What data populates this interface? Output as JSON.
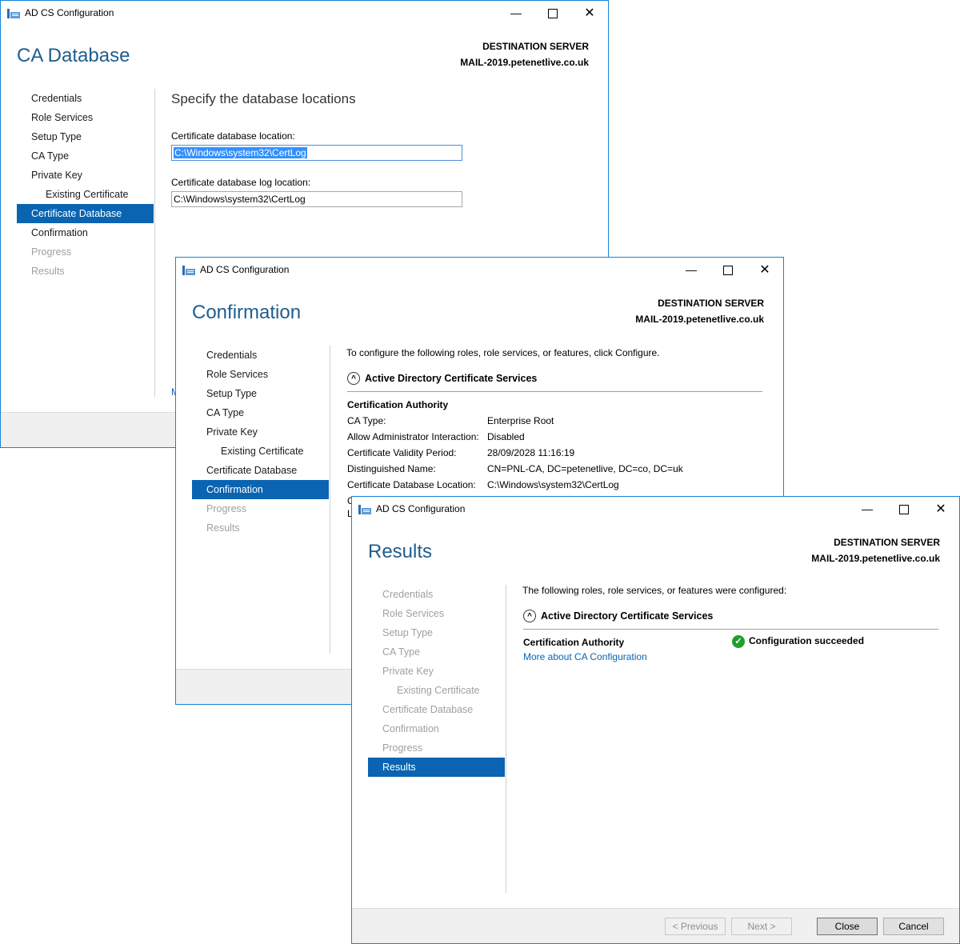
{
  "app_title": "AD CS Configuration",
  "destination": {
    "label": "DESTINATION SERVER",
    "server": "MAIL-2019.petenetlive.co.uk"
  },
  "nav_items": {
    "credentials": "Credentials",
    "role_services": "Role Services",
    "setup_type": "Setup Type",
    "ca_type": "CA Type",
    "private_key": "Private Key",
    "existing_certificate": "Existing Certificate",
    "certificate_database": "Certificate Database",
    "confirmation": "Confirmation",
    "progress": "Progress",
    "results": "Results"
  },
  "window1": {
    "page_title": "CA Database",
    "heading": "Specify the database locations",
    "db_location_label": "Certificate database location:",
    "db_location_value": "C:\\Windows\\system32\\CertLog",
    "log_location_label": "Certificate database log location:",
    "log_location_value": "C:\\Windows\\system32\\CertLog",
    "more_link_fragment": "M"
  },
  "window2": {
    "page_title": "Confirmation",
    "intro": "To configure the following roles, role services, or features, click Configure.",
    "section_title": "Active Directory Certificate Services",
    "group_title": "Certification Authority",
    "details": [
      {
        "key": "CA Type:",
        "value": "Enterprise Root"
      },
      {
        "key": "Allow Administrator Interaction:",
        "value": "Disabled"
      },
      {
        "key": "Certificate Validity Period:",
        "value": "28/09/2028 11:16:19"
      },
      {
        "key": "Distinguished Name:",
        "value": "CN=PNL-CA, DC=petenetlive, DC=co, DC=uk"
      },
      {
        "key": "Certificate Database Location:",
        "value": "C:\\Windows\\system32\\CertLog"
      }
    ],
    "clipped_rows": [
      "C",
      "L"
    ]
  },
  "window3": {
    "page_title": "Results",
    "intro": "The following roles, role services, or features were configured:",
    "section_title": "Active Directory Certificate Services",
    "group_title": "Certification Authority",
    "status": "Configuration succeeded",
    "more_link": "More about CA Configuration",
    "buttons": {
      "previous": "< Previous",
      "next": "Next >",
      "close": "Close",
      "cancel": "Cancel"
    }
  }
}
